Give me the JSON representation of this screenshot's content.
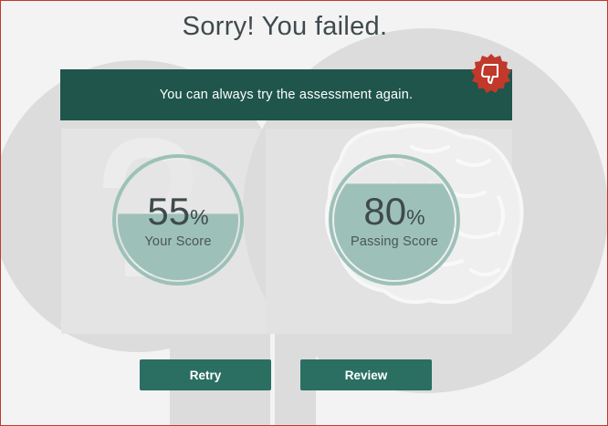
{
  "result": {
    "title": "Sorry! You failed.",
    "message": "You can always try the assessment again."
  },
  "scores": {
    "your_score": {
      "value": "55",
      "unit": "%",
      "label": "Your Score",
      "fill_fraction": 0.55
    },
    "passing_score": {
      "value": "80",
      "unit": "%",
      "label": "Passing Score",
      "fill_fraction": 0.8
    }
  },
  "actions": {
    "retry_label": "Retry",
    "review_label": "Review"
  },
  "icons": {
    "badge": "thumbs-down-icon",
    "background_left": "question-head-icon",
    "background_right": "brain-head-icon"
  },
  "colors": {
    "banner": "#1f554b",
    "button": "#2a6f62",
    "gauge_fill": "#9dc1b8",
    "gauge_ring": "#9dc1b8",
    "badge": "#c0392b",
    "frame_border": "#c0392b",
    "title_text": "#3f4a4d"
  }
}
